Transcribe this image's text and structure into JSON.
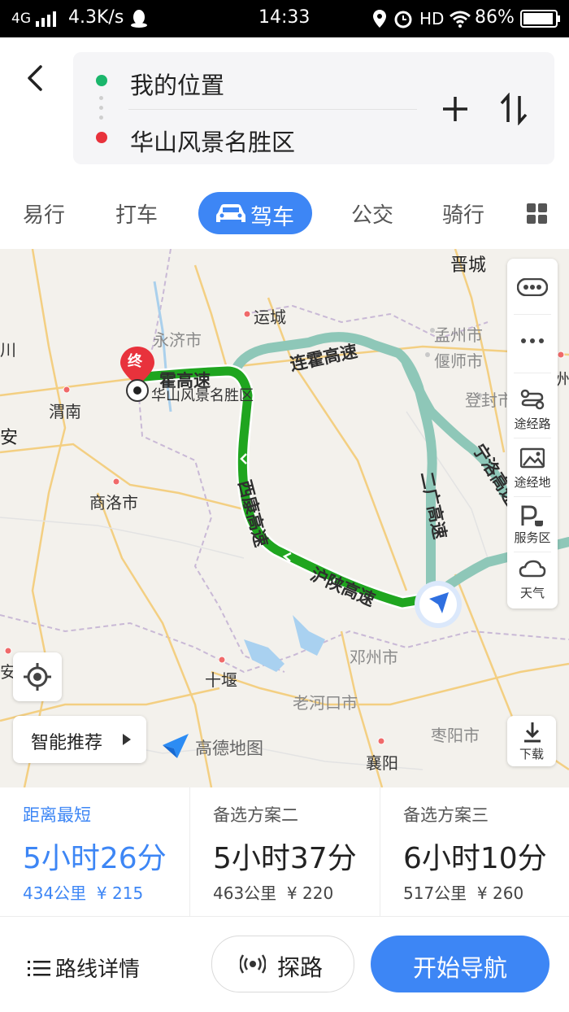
{
  "status_bar": {
    "network": "4G",
    "speed": "4.3K/s",
    "time": "14:33",
    "hd": "HD",
    "battery": "86%"
  },
  "header": {
    "origin": "我的位置",
    "destination": "华山风景名胜区",
    "add_icon": "plus-icon",
    "swap_icon": "swap-icon",
    "origin_color": "#1bb66c",
    "destination_color": "#e8323c"
  },
  "tabs": {
    "items": [
      "易行",
      "打车",
      "驾车",
      "公交",
      "骑行"
    ],
    "active": "驾车",
    "accent": "#3d86f5"
  },
  "map": {
    "end_marker": "终",
    "destination_label": "华山风景名胜区",
    "cities": {
      "jincheng": "晋城",
      "yuncheng": "运城",
      "yongji": "永济市",
      "mengzhou": "孟州市",
      "yanshi": "偃师市",
      "dengfeng": "登封市",
      "weinan": "渭南",
      "xian_partial": "安",
      "chuan_partial": "川",
      "zheng_partial": "郑州",
      "shangluo": "商洛市",
      "shiyan": "十堰",
      "laohekou": "老河口市",
      "dengzhou": "邓州市",
      "zaoyang": "枣阳市",
      "xiangyang": "襄阳",
      "an_partial": "安"
    },
    "roads": {
      "lianhuo": "连霍高速",
      "lianhuo_partial": "霍高速",
      "xikang": "西康高速",
      "hushan": "沪陕高速",
      "erguang": "二广高速",
      "ningluo": "宁洛高速"
    },
    "logo_text": "高德地图",
    "side_panel": [
      "途经路",
      "途经地",
      "服务区",
      "天气"
    ],
    "recommend": "智能推荐",
    "download": "下载",
    "route_color": "#1fa51f",
    "alt_route_color": "#8ec7b8"
  },
  "options": [
    {
      "tag": "距离最短",
      "time": "5小时26分",
      "distance": "434公里",
      "cost": "¥ 215",
      "active": true
    },
    {
      "tag": "备选方案二",
      "time": "5小时37分",
      "distance": "463公里",
      "cost": "¥ 220",
      "active": false
    },
    {
      "tag": "备选方案三",
      "time": "6小时10分",
      "distance": "517公里",
      "cost": "¥ 260",
      "active": false
    }
  ],
  "actions": {
    "details": "路线详情",
    "explore": "探路",
    "start": "开始导航"
  }
}
